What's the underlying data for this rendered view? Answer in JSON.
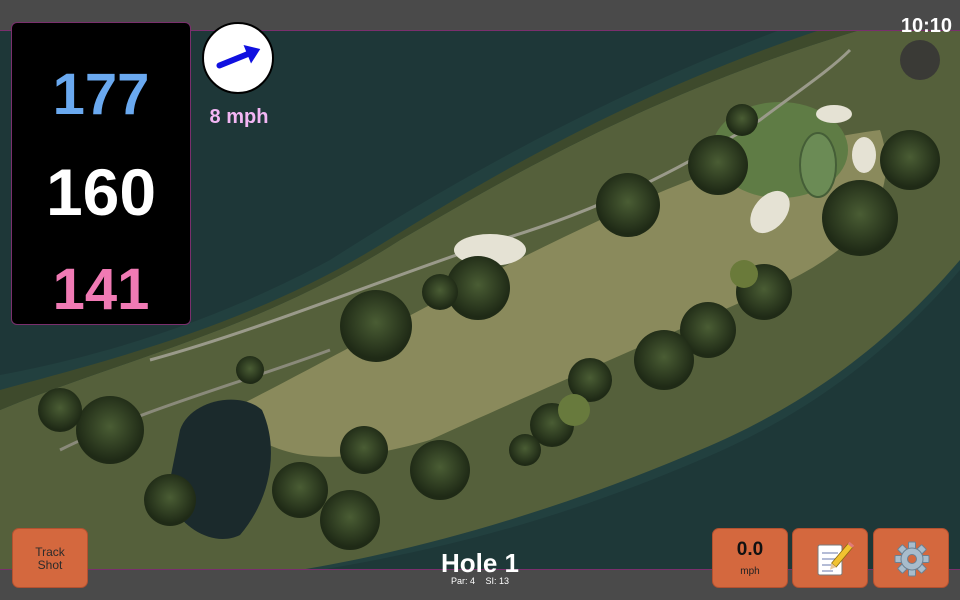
{
  "status": {
    "clock": "10:10"
  },
  "yardage": {
    "back": "177",
    "middle": "160",
    "front": "141",
    "colors": {
      "back": "#6aa9f0",
      "middle": "#ffffff",
      "front": "#f07ab4"
    }
  },
  "wind": {
    "speed": "8 mph",
    "icon": "arrow-northeast-icon",
    "color": "#f3b6f4",
    "arrow_color": "#1010e0"
  },
  "hole": {
    "title": "Hole 1",
    "par": "Par: 4",
    "si": "SI: 13"
  },
  "buttons": {
    "track_shot": "Track\nShot",
    "speed_value": "0.0",
    "speed_unit": "mph",
    "notes_icon": "notepad-icon",
    "settings_icon": "gear-icon"
  },
  "colors": {
    "accent": "#d4683e",
    "divider": "#7a2f6d",
    "bar": "#4a4a4a"
  }
}
